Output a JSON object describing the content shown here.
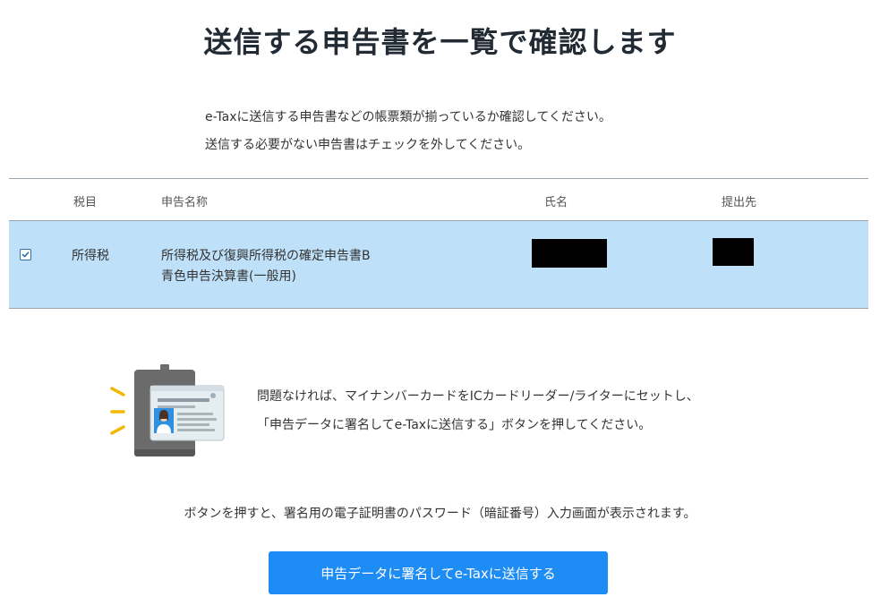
{
  "page": {
    "title": "送信する申告書を一覧で確認します",
    "intro": [
      "e-Taxに送信する申告書などの帳票類が揃っているか確認してください。",
      "送信する必要がない申告書はチェックを外してください。"
    ]
  },
  "table": {
    "headers": {
      "tax_item": "税目",
      "form_name": "申告名称",
      "person": "氏名",
      "destination": "提出先"
    },
    "rows": [
      {
        "checked": true,
        "tax_item": "所得税",
        "form_names": [
          "所得税及び復興所得税の確定申告書B",
          "青色申告決算書(一般用)"
        ]
      }
    ]
  },
  "guide": {
    "icon": "my-number-card-reader-icon",
    "lines": [
      "問題なければ、マイナンバーカードをICカードリーダー/ライターにセットし、",
      "「申告データに署名してe-Taxに送信する」ボタンを押してください。"
    ]
  },
  "note": "ボタンを押すと、署名用の電子証明書のパスワード（暗証番号）入力画面が表示されます。",
  "submit_button": {
    "label": "申告データに署名してe-Taxに送信する",
    "color": "#1e8cf5"
  },
  "colors": {
    "selected_row": "#bfe0f9",
    "title_text": "#222a33"
  }
}
